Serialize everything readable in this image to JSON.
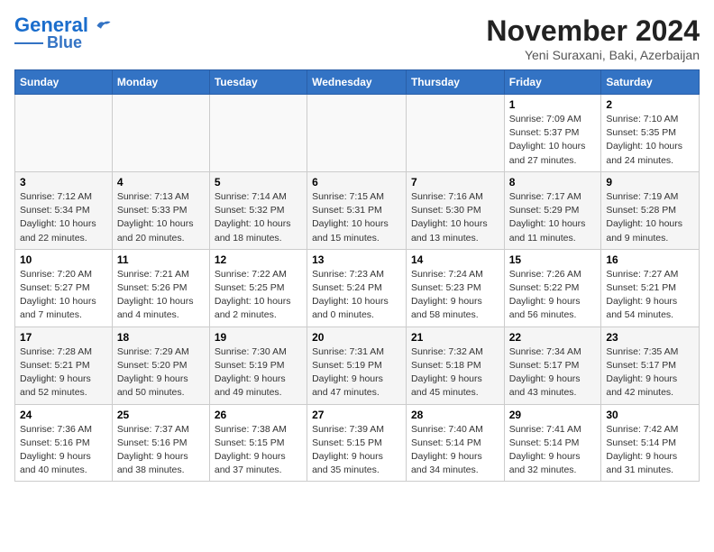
{
  "logo": {
    "line1": "General",
    "line2": "Blue"
  },
  "title": "November 2024",
  "subtitle": "Yeni Suraxani, Baki, Azerbaijan",
  "days_of_week": [
    "Sunday",
    "Monday",
    "Tuesday",
    "Wednesday",
    "Thursday",
    "Friday",
    "Saturday"
  ],
  "weeks": [
    [
      {
        "day": "",
        "info": ""
      },
      {
        "day": "",
        "info": ""
      },
      {
        "day": "",
        "info": ""
      },
      {
        "day": "",
        "info": ""
      },
      {
        "day": "",
        "info": ""
      },
      {
        "day": "1",
        "info": "Sunrise: 7:09 AM\nSunset: 5:37 PM\nDaylight: 10 hours and 27 minutes."
      },
      {
        "day": "2",
        "info": "Sunrise: 7:10 AM\nSunset: 5:35 PM\nDaylight: 10 hours and 24 minutes."
      }
    ],
    [
      {
        "day": "3",
        "info": "Sunrise: 7:12 AM\nSunset: 5:34 PM\nDaylight: 10 hours and 22 minutes."
      },
      {
        "day": "4",
        "info": "Sunrise: 7:13 AM\nSunset: 5:33 PM\nDaylight: 10 hours and 20 minutes."
      },
      {
        "day": "5",
        "info": "Sunrise: 7:14 AM\nSunset: 5:32 PM\nDaylight: 10 hours and 18 minutes."
      },
      {
        "day": "6",
        "info": "Sunrise: 7:15 AM\nSunset: 5:31 PM\nDaylight: 10 hours and 15 minutes."
      },
      {
        "day": "7",
        "info": "Sunrise: 7:16 AM\nSunset: 5:30 PM\nDaylight: 10 hours and 13 minutes."
      },
      {
        "day": "8",
        "info": "Sunrise: 7:17 AM\nSunset: 5:29 PM\nDaylight: 10 hours and 11 minutes."
      },
      {
        "day": "9",
        "info": "Sunrise: 7:19 AM\nSunset: 5:28 PM\nDaylight: 10 hours and 9 minutes."
      }
    ],
    [
      {
        "day": "10",
        "info": "Sunrise: 7:20 AM\nSunset: 5:27 PM\nDaylight: 10 hours and 7 minutes."
      },
      {
        "day": "11",
        "info": "Sunrise: 7:21 AM\nSunset: 5:26 PM\nDaylight: 10 hours and 4 minutes."
      },
      {
        "day": "12",
        "info": "Sunrise: 7:22 AM\nSunset: 5:25 PM\nDaylight: 10 hours and 2 minutes."
      },
      {
        "day": "13",
        "info": "Sunrise: 7:23 AM\nSunset: 5:24 PM\nDaylight: 10 hours and 0 minutes."
      },
      {
        "day": "14",
        "info": "Sunrise: 7:24 AM\nSunset: 5:23 PM\nDaylight: 9 hours and 58 minutes."
      },
      {
        "day": "15",
        "info": "Sunrise: 7:26 AM\nSunset: 5:22 PM\nDaylight: 9 hours and 56 minutes."
      },
      {
        "day": "16",
        "info": "Sunrise: 7:27 AM\nSunset: 5:21 PM\nDaylight: 9 hours and 54 minutes."
      }
    ],
    [
      {
        "day": "17",
        "info": "Sunrise: 7:28 AM\nSunset: 5:21 PM\nDaylight: 9 hours and 52 minutes."
      },
      {
        "day": "18",
        "info": "Sunrise: 7:29 AM\nSunset: 5:20 PM\nDaylight: 9 hours and 50 minutes."
      },
      {
        "day": "19",
        "info": "Sunrise: 7:30 AM\nSunset: 5:19 PM\nDaylight: 9 hours and 49 minutes."
      },
      {
        "day": "20",
        "info": "Sunrise: 7:31 AM\nSunset: 5:19 PM\nDaylight: 9 hours and 47 minutes."
      },
      {
        "day": "21",
        "info": "Sunrise: 7:32 AM\nSunset: 5:18 PM\nDaylight: 9 hours and 45 minutes."
      },
      {
        "day": "22",
        "info": "Sunrise: 7:34 AM\nSunset: 5:17 PM\nDaylight: 9 hours and 43 minutes."
      },
      {
        "day": "23",
        "info": "Sunrise: 7:35 AM\nSunset: 5:17 PM\nDaylight: 9 hours and 42 minutes."
      }
    ],
    [
      {
        "day": "24",
        "info": "Sunrise: 7:36 AM\nSunset: 5:16 PM\nDaylight: 9 hours and 40 minutes."
      },
      {
        "day": "25",
        "info": "Sunrise: 7:37 AM\nSunset: 5:16 PM\nDaylight: 9 hours and 38 minutes."
      },
      {
        "day": "26",
        "info": "Sunrise: 7:38 AM\nSunset: 5:15 PM\nDaylight: 9 hours and 37 minutes."
      },
      {
        "day": "27",
        "info": "Sunrise: 7:39 AM\nSunset: 5:15 PM\nDaylight: 9 hours and 35 minutes."
      },
      {
        "day": "28",
        "info": "Sunrise: 7:40 AM\nSunset: 5:14 PM\nDaylight: 9 hours and 34 minutes."
      },
      {
        "day": "29",
        "info": "Sunrise: 7:41 AM\nSunset: 5:14 PM\nDaylight: 9 hours and 32 minutes."
      },
      {
        "day": "30",
        "info": "Sunrise: 7:42 AM\nSunset: 5:14 PM\nDaylight: 9 hours and 31 minutes."
      }
    ]
  ]
}
